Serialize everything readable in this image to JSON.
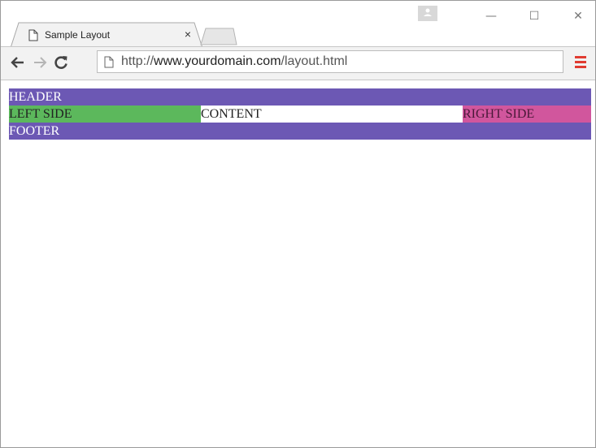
{
  "browser": {
    "tab_title": "Sample Layout",
    "tab_close_glyph": "×",
    "url_scheme": "http://",
    "url_host": "www.yourdomain.com",
    "url_path": "/layout.html",
    "window_buttons": {
      "minimize": "—",
      "maximize": "☐",
      "close": "✕"
    },
    "icons": [
      "page-icon",
      "back-arrow-icon",
      "forward-arrow-icon",
      "reload-icon",
      "menu-icon",
      "profile-icon"
    ],
    "accent_menu_color": "#e03c31"
  },
  "page": {
    "header": "HEADER",
    "left_side": "LEFT SIDE",
    "content": "CONTENT",
    "right_side": "RIGHT SIDE",
    "footer": "FOOTER",
    "colors": {
      "header": "#6c58b4",
      "left_side": "#5cb85c",
      "content": "#ffffff",
      "right_side": "#d1569d",
      "footer": "#6c58b4"
    }
  }
}
